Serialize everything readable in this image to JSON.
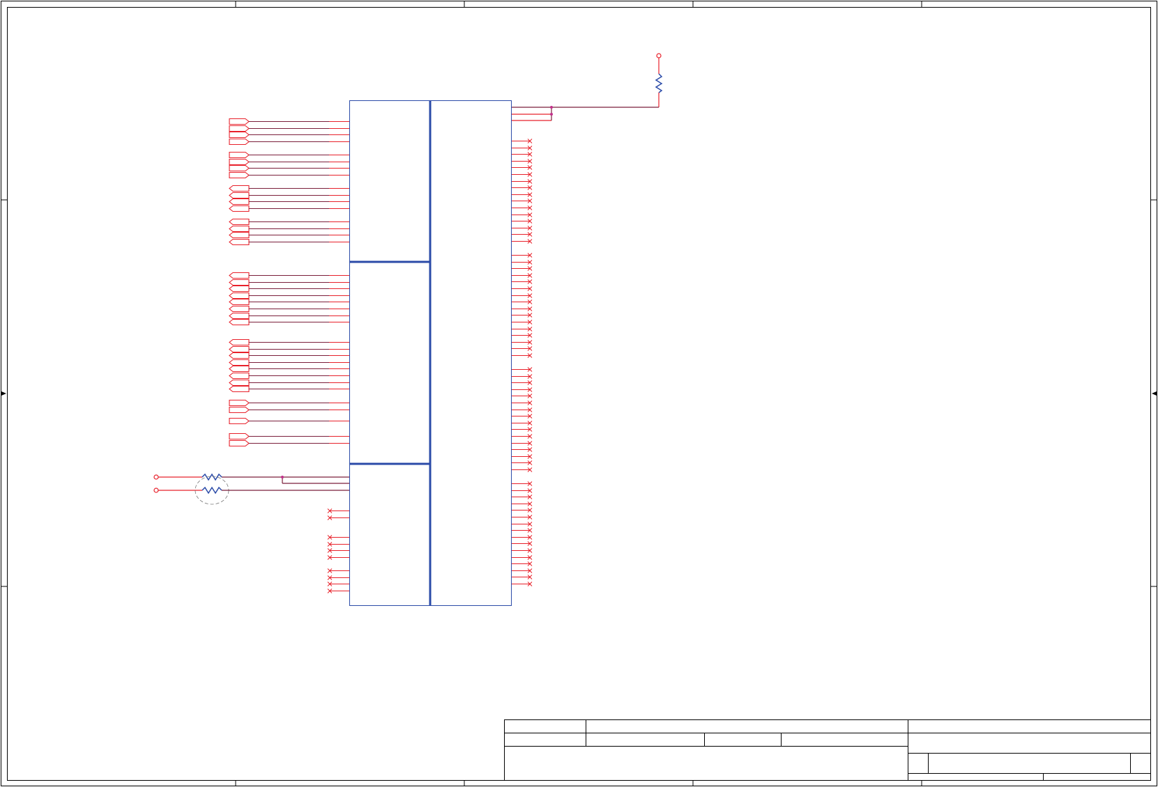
{
  "sheet": {
    "title_block": {
      "cells": []
    },
    "zone_markers": {
      "side_arrows": "▶"
    }
  },
  "schematic": {
    "ic": {
      "sections": 3,
      "line_color": "#2b4ba8"
    },
    "net_color": "#e8202a",
    "wire_color": "#7a1e3a",
    "junction_color": "#c0308a",
    "left_port_groups": [
      {
        "direction": "output",
        "count": 4
      },
      {
        "direction": "output",
        "count": 4
      },
      {
        "direction": "input",
        "count": 4
      },
      {
        "direction": "input",
        "count": 4
      },
      {
        "direction": "input",
        "count": 8
      },
      {
        "direction": "input",
        "count": 8
      },
      {
        "direction": "output",
        "count": 2
      },
      {
        "direction": "output",
        "count": 1
      },
      {
        "direction": "output",
        "count": 2
      }
    ],
    "right_nc_groups": [
      16,
      16,
      16,
      16
    ],
    "left_nc_groups": [
      2,
      4,
      4
    ],
    "resistor_network": {
      "resistors": 2,
      "power_terminals": 2
    },
    "pullup": {
      "resistors": 1,
      "power_terminals": 1
    }
  }
}
